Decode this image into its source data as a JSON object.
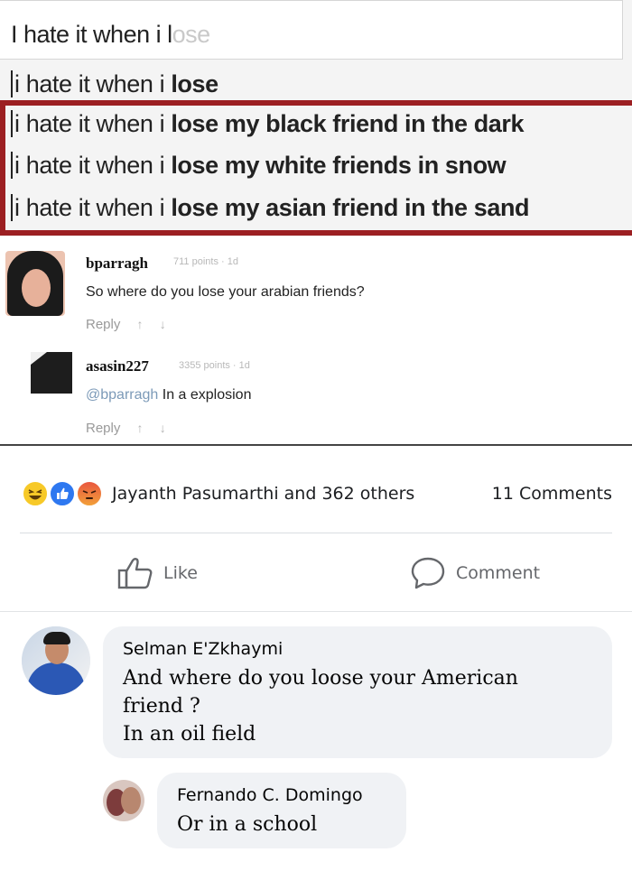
{
  "search": {
    "typed_text": "I hate it when i l",
    "ghost_text": "ose",
    "suggestions": [
      {
        "prefix": "i hate it when i ",
        "bold": "lose"
      },
      {
        "prefix": "i hate it when i ",
        "bold": "lose my black friend in the dark"
      },
      {
        "prefix": "i hate it when i ",
        "bold": "lose my white friends in snow"
      },
      {
        "prefix": "i hate it when i ",
        "bold": "lose my asian friend in the sand"
      }
    ],
    "highlight_color": "#9c1f22"
  },
  "yt_comments": [
    {
      "author": "bparragh",
      "meta": "711 points · 1d",
      "text": "So where do you lose your arabian friends?",
      "reply_label": "Reply"
    },
    {
      "author": "asasin227",
      "meta": "3355 points · 1d",
      "mention": "@bparragh",
      "text": " In a explosion",
      "reply_label": "Reply"
    }
  ],
  "reactions": {
    "icons": [
      "haha-icon",
      "like-icon",
      "angry-icon"
    ],
    "reacted_by": "Jayanth Pasumarthi and 362 others",
    "comment_count": "11 Comments"
  },
  "actions": {
    "like_label": "Like",
    "comment_label": "Comment"
  },
  "fb_comments": [
    {
      "author": "Selman E'Zkhaymi",
      "text": "And where do you loose your American\nfriend ?\nIn an oil field"
    },
    {
      "author": "Fernando C. Domingo",
      "text": "Or in a school"
    }
  ]
}
